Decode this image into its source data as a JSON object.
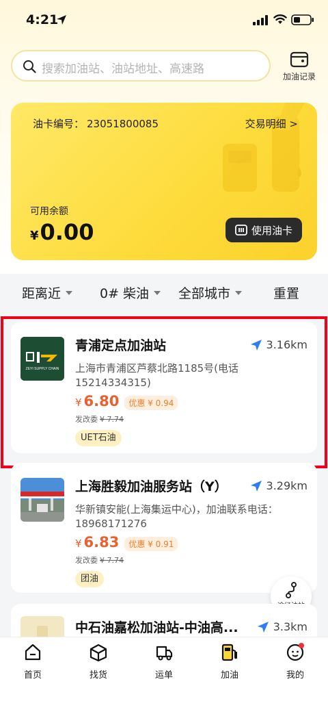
{
  "status_bar": {
    "time": "4:21"
  },
  "search": {
    "placeholder": "搜索加油站、油站地址、高速路",
    "record_label": "加油记录"
  },
  "fuel_card": {
    "card_no_label": "油卡编号：",
    "card_no": "23051800085",
    "transactions_label": "交易明细 >",
    "balance_label": "可用余额",
    "currency": "¥",
    "balance": "0.00",
    "use_card_label": "使用油卡"
  },
  "filters": [
    {
      "label": "距离近"
    },
    {
      "label": "0# 柴油"
    },
    {
      "label": "全部城市"
    },
    {
      "label": "重置"
    }
  ],
  "stations": [
    {
      "name": "青浦定点加油站",
      "distance": "3.16km",
      "address": "上海市青浦区芦蔡北路1185号(电话15214334315)",
      "currency": "¥",
      "price": "6.80",
      "discount": "优惠 ¥ 0.94",
      "orig_label": "发改委",
      "orig_price": "¥ 7.74",
      "tag": "UET石油",
      "logo_text": "ZEYI SUPPLY CHAIN"
    },
    {
      "name": "上海胜毅加油服务站（Y）",
      "distance": "3.29km",
      "address": "华新镇安能(上海集运中心)，加油联系电话：18968171276",
      "currency": "¥",
      "price": "6.83",
      "discount": "优惠 ¥ 0.91",
      "orig_label": "发改委",
      "orig_price": "¥ 7.74",
      "tag": "团油"
    },
    {
      "name": "中石油嘉松加油站-中油高...",
      "distance": "3.3km"
    }
  ],
  "route_button": {
    "label": "途径油站"
  },
  "bottom_nav": [
    {
      "label": "首页",
      "icon": "home-icon"
    },
    {
      "label": "找货",
      "icon": "box-icon"
    },
    {
      "label": "运单",
      "icon": "truck-icon"
    },
    {
      "label": "加油",
      "icon": "fuel-icon"
    },
    {
      "label": "我的",
      "icon": "profile-icon"
    }
  ],
  "colors": {
    "accent_yellow": "#fdd835",
    "price_orange": "#e8612e",
    "highlight_red": "#f0001a"
  }
}
